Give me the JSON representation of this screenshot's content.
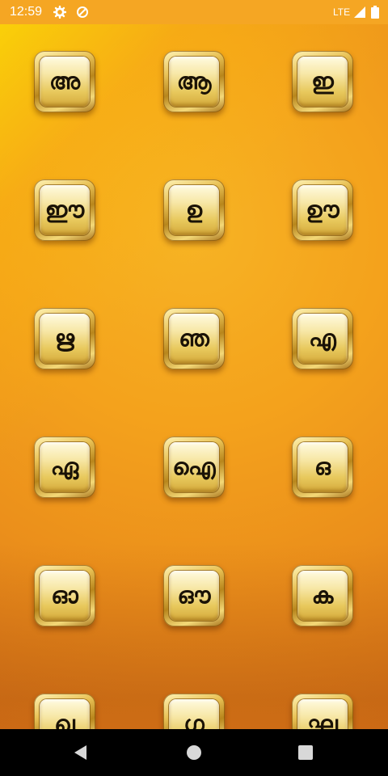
{
  "status_bar": {
    "time": "12:59",
    "network": "LTE",
    "icons": [
      "gear-icon",
      "data-saver-icon",
      "signal-icon",
      "battery-icon"
    ]
  },
  "letters": [
    "അ",
    "ആ",
    "ഇ",
    "ഈ",
    "ഉ",
    "ഊ",
    "ഋ",
    "ഞ",
    "എ",
    "ഏ",
    "ഐ",
    "ഒ",
    "ഓ",
    "ഔ",
    "ക",
    "ഖ",
    "ഗ",
    "ഘ"
  ],
  "nav_bar": {
    "icons": [
      "back-icon",
      "home-icon",
      "recents-icon"
    ]
  },
  "colors": {
    "status_bar": "#f5a623",
    "tile_text": "#1a1206",
    "nav_bar": "#000000"
  }
}
